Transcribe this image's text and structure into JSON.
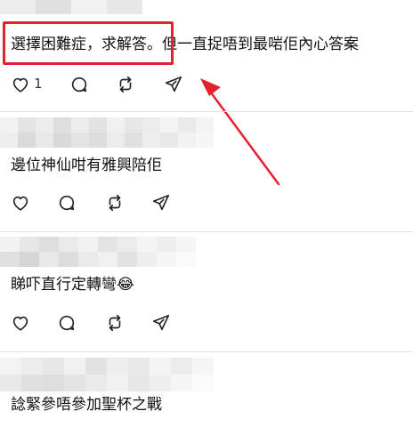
{
  "posts": [
    {
      "text": "選擇困難症，求解答。但一直捉唔到最啱佢內心答案",
      "like_count": "1"
    },
    {
      "text": "邊位神仙咁有雅興陪佢",
      "like_count": ""
    },
    {
      "text": "睇吓直行定轉彎😂",
      "like_count": ""
    },
    {
      "text": "諗緊參唔參加聖杯之戰",
      "like_count": ""
    }
  ],
  "icons": {
    "like": "heart-icon",
    "reply": "comment-icon",
    "repost": "repost-icon",
    "share": "send-icon"
  },
  "annotation": {
    "color": "#e3232c"
  }
}
